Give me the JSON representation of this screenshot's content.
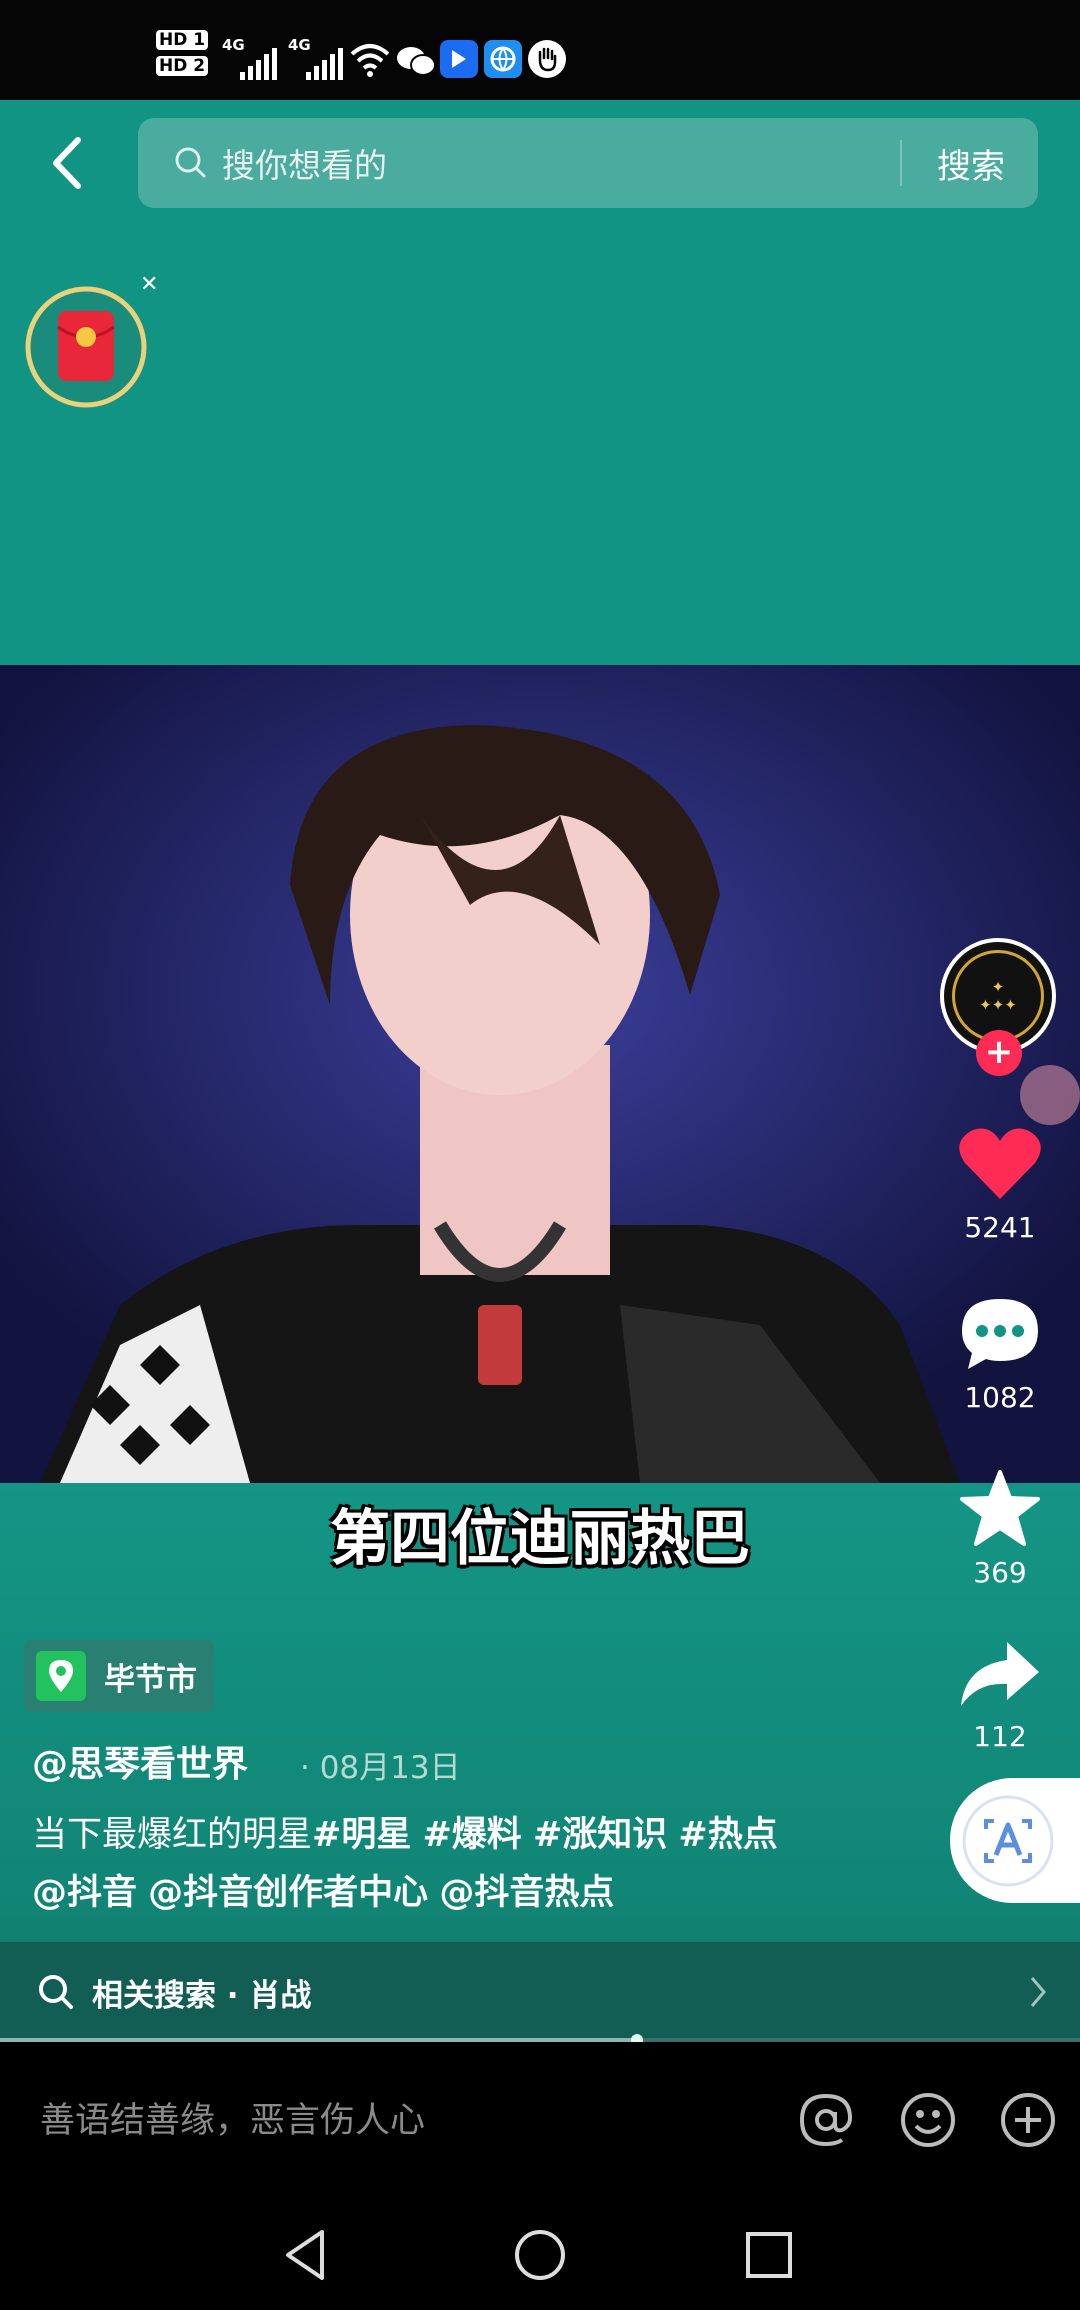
{
  "status_bar": {
    "hd1": "HD 1",
    "hd2": "HD 2",
    "net1": "4G",
    "net2": "4G"
  },
  "search": {
    "placeholder": "搜你想看的",
    "button": "搜索"
  },
  "video": {
    "caption": "第四位迪丽热巴"
  },
  "actions": {
    "likes": "5241",
    "comments": "1082",
    "favorites": "369",
    "shares": "112"
  },
  "post": {
    "location": "毕节市",
    "author": "@思琴看世界",
    "date": "· 08月13日",
    "description_text": "当下最爆红的明星",
    "hashtags": [
      "#明星",
      "#爆料",
      "#涨知识",
      "#热点"
    ],
    "mentions": [
      "@抖音",
      "@抖音创作者中心",
      "@抖音热点"
    ]
  },
  "related_search": {
    "label": "相关搜索 · 肖战"
  },
  "progress": 0.59,
  "comment_bar": {
    "placeholder": "善语结善缘，恶言伤人心"
  },
  "colors": {
    "teal": "#129484",
    "like_red": "#fe2c55",
    "red_packet": "#e8283a"
  }
}
